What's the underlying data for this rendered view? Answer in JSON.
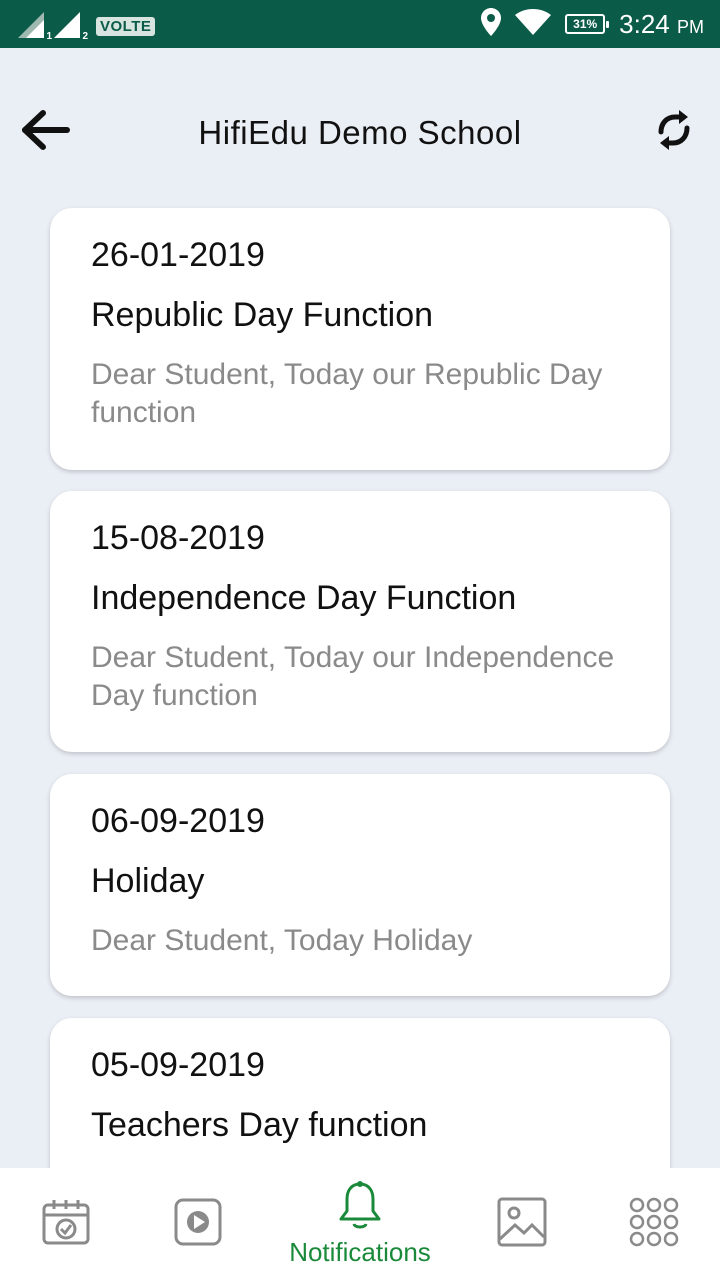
{
  "status_bar": {
    "sim1_label": "1",
    "sim2_label": "2",
    "network_badge": "VOLTE",
    "battery": "31%",
    "time": "3:24",
    "ampm": "PM",
    "icons": [
      "signal-icon",
      "location-icon",
      "wifi-icon",
      "battery-icon"
    ]
  },
  "header": {
    "title": "HifiEdu Demo School",
    "back_icon": "back-arrow-icon",
    "refresh_icon": "refresh-icon"
  },
  "notifications": [
    {
      "date": "26-01-2019",
      "title": "Republic Day Function",
      "message": "Dear Student, Today our Republic Day function"
    },
    {
      "date": "15-08-2019",
      "title": "Independence Day Function",
      "message": "Dear Student, Today our Independence Day function"
    },
    {
      "date": "06-09-2019",
      "title": "Holiday",
      "message": "Dear Student, Today Holiday"
    },
    {
      "date": "05-09-2019",
      "title": "Teachers Day function",
      "message": ""
    }
  ],
  "bottom_nav": {
    "active_label": "Notifications",
    "items": [
      "calendar-icon",
      "video-icon",
      "bell-icon",
      "gallery-icon",
      "apps-grid-icon"
    ]
  },
  "colors": {
    "status_bar": "#0b5b49",
    "background": "#eaeef5",
    "active_nav": "#1a8a3a",
    "inactive_icon": "#8a8a8a",
    "message_text": "#8a8a8a"
  }
}
